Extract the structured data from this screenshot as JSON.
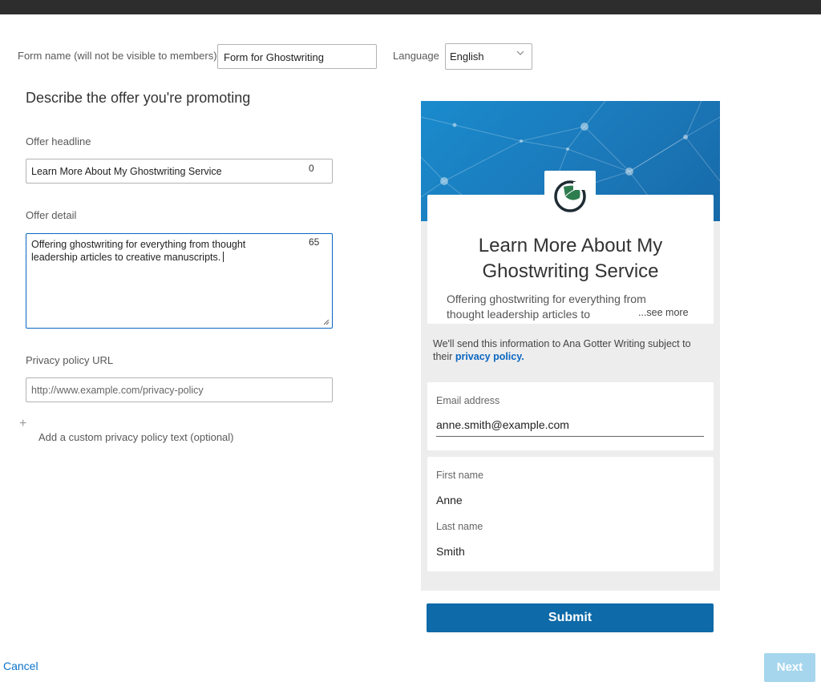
{
  "form": {
    "name_label": "Form name (will not be visible to members)",
    "name_value": "Form for Ghostwriting",
    "language_label": "Language",
    "language_value": "English"
  },
  "section": {
    "title": "Describe the offer you're promoting",
    "headline_label": "Offer headline",
    "headline_value": "Learn More About My Ghostwriting Service",
    "headline_counter": "0",
    "detail_label": "Offer detail",
    "detail_value": "Offering ghostwriting for everything from thought leadership articles to creative manuscripts.",
    "detail_counter": "65",
    "privacy_label": "Privacy policy URL",
    "privacy_placeholder": "http://www.example.com/privacy-policy",
    "custom_privacy_label": "Add a custom privacy policy text (optional)"
  },
  "preview": {
    "title": "Learn More About My Ghostwriting Service",
    "detail": "Offering ghostwriting for everything from thought leadership articles to",
    "see_more": "...see more",
    "consent_text": "We'll send this information to Ana Gotter Writing subject to their",
    "consent_link": "privacy policy.",
    "email_label": "Email address",
    "email_value": "anne.smith@example.com",
    "first_name_label": "First name",
    "first_name_value": "Anne",
    "last_name_label": "Last name",
    "last_name_value": "Smith",
    "submit_label": "Submit",
    "banner_color": "#1a8bcd",
    "logo_icon": "leaf-logo-icon"
  },
  "footer": {
    "cancel_label": "Cancel",
    "next_label": "Next"
  }
}
